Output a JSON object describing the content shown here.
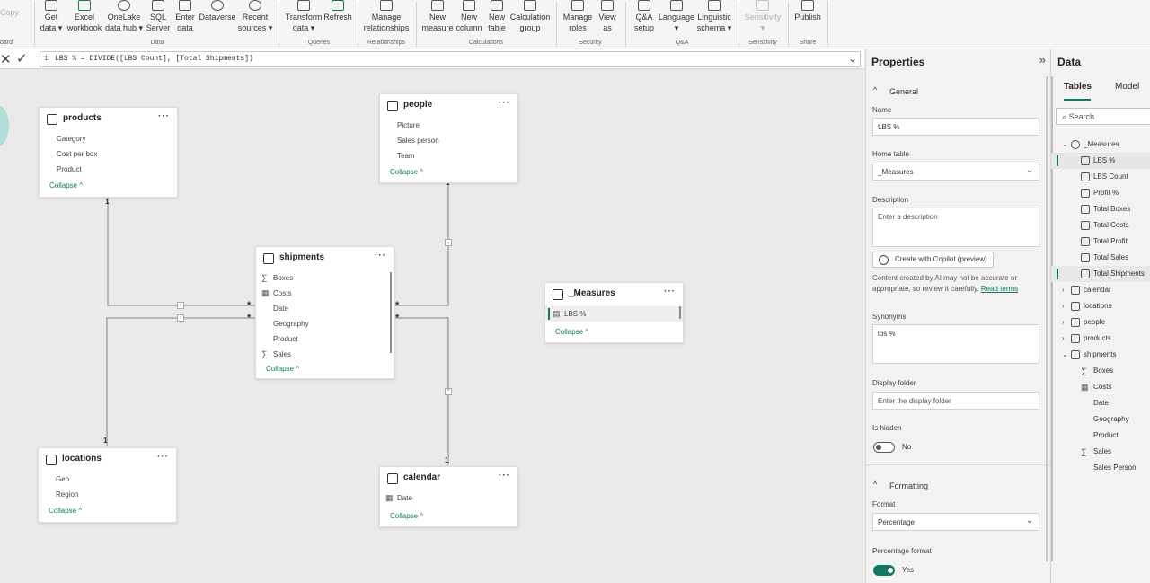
{
  "ribbon": {
    "clipboard_partial": "Copy",
    "clipboard_group_partial": "oard",
    "buttons": {
      "get_data": [
        "Get",
        "data ▾"
      ],
      "excel": [
        "Excel",
        "workbook"
      ],
      "onelake": [
        "OneLake",
        "data hub ▾"
      ],
      "sql": [
        "SQL",
        "Server"
      ],
      "enter_data": [
        "Enter",
        "data"
      ],
      "dataverse": [
        "Dataverse",
        ""
      ],
      "recent": [
        "Recent",
        "sources ▾"
      ],
      "transform": [
        "Transform",
        "data ▾"
      ],
      "refresh": [
        "Refresh",
        ""
      ],
      "manage_rel": [
        "Manage",
        "relationships"
      ],
      "new_measure": [
        "New",
        "measure"
      ],
      "new_column": [
        "New",
        "column"
      ],
      "new_table": [
        "New",
        "table"
      ],
      "calc_group": [
        "Calculation",
        "group"
      ],
      "manage_roles": [
        "Manage",
        "roles"
      ],
      "view_as": [
        "View",
        "as"
      ],
      "qa_setup": [
        "Q&A",
        "setup"
      ],
      "language": [
        "Language",
        "▾"
      ],
      "linguistic": [
        "Linguistic",
        "schema ▾"
      ],
      "sensitivity": [
        "Sensitivity",
        "▾"
      ],
      "publish": [
        "Publish",
        ""
      ]
    },
    "groups": {
      "data": "Data",
      "queries": "Queries",
      "relationships": "Relationships",
      "calculations": "Calculations",
      "security": "Security",
      "qa": "Q&A",
      "sensitivity": "Sensitivity",
      "share": "Share"
    }
  },
  "formula": {
    "line_number": "1",
    "text": "LBS % = DIVIDE([LBS Count], [Total Shipments])"
  },
  "tables": {
    "products": {
      "title": "products",
      "fields": [
        "Category",
        "Cost per box",
        "Product"
      ],
      "collapse": "Collapse ^"
    },
    "people": {
      "title": "people",
      "fields": [
        "Picture",
        "Sales person",
        "Team"
      ],
      "collapse": "Collapse ^"
    },
    "shipments": {
      "title": "shipments",
      "fields": [
        "Boxes",
        "Costs",
        "Date",
        "Geography",
        "Product",
        "Sales"
      ],
      "collapse": "Collapse ^"
    },
    "measures": {
      "title": "_Measures",
      "fields": [
        "LBS %"
      ],
      "collapse": "Collapse ^"
    },
    "locations": {
      "title": "locations",
      "fields": [
        "Geo",
        "Region"
      ],
      "collapse": "Collapse ^"
    },
    "calendar": {
      "title": "calendar",
      "fields": [
        "Date"
      ],
      "collapse": "Collapse ^"
    }
  },
  "relationships": {
    "one": "1",
    "many": "*"
  },
  "properties": {
    "title": "Properties",
    "general": "General",
    "name_label": "Name",
    "name_value": "LBS %",
    "home_label": "Home table",
    "home_value": "_Measures",
    "desc_label": "Description",
    "desc_placeholder": "Enter a description",
    "copilot": "Create with Copilot (preview)",
    "note": "Content created by AI may not be accurate or appropriate, so review it carefully.",
    "note_link": "Read terms",
    "syn_label": "Synonyms",
    "syn_value": "lbs %",
    "folder_label": "Display folder",
    "folder_placeholder": "Enter the display folder",
    "hidden_label": "Is hidden",
    "hidden_value": "No",
    "formatting": "Formatting",
    "format_label": "Format",
    "format_value": "Percentage",
    "pctfmt_label": "Percentage format",
    "pctfmt_value": "Yes"
  },
  "data_pane": {
    "title": "Data",
    "tab_tables": "Tables",
    "tab_model": "Model",
    "search_placeholder": "Search",
    "measures_table": "_Measures",
    "measures": [
      "LBS %",
      "LBS Count",
      "Profit %",
      "Total Boxes",
      "Total Costs",
      "Total Profit",
      "Total Sales",
      "Total Shipments"
    ],
    "tables": [
      "calendar",
      "locations",
      "people",
      "products",
      "shipments"
    ],
    "shipments_fields": [
      "Boxes",
      "Costs",
      "Date",
      "Geography",
      "Product",
      "Sales",
      "Sales Person"
    ]
  },
  "colors": {
    "accent": "#117865",
    "canvas": "#ebeae8"
  }
}
